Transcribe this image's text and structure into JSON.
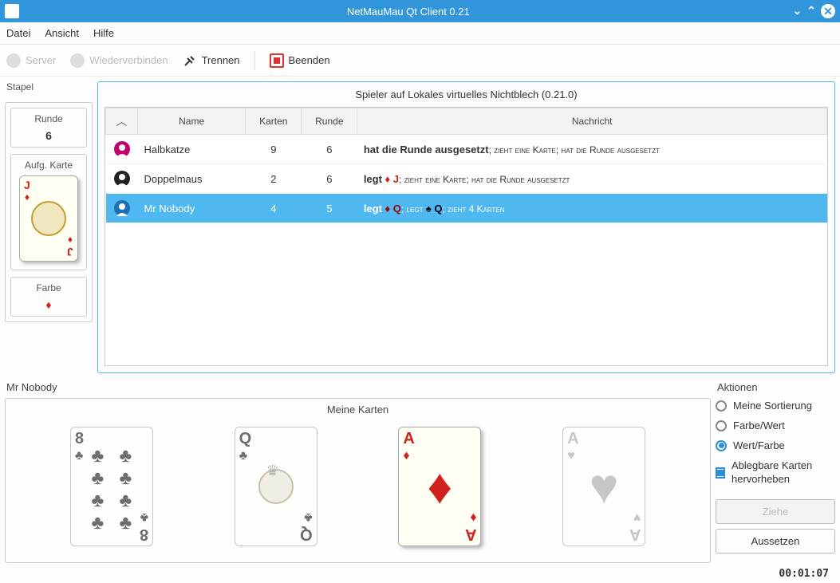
{
  "window": {
    "title": "NetMauMau Qt Client 0.21"
  },
  "menubar": {
    "file": "Datei",
    "view": "Ansicht",
    "help": "Hilfe"
  },
  "toolbar": {
    "server": "Server",
    "reconnect": "Wiederverbinden",
    "disconnect": "Trennen",
    "quit": "Beenden"
  },
  "stapel": {
    "title": "Stapel",
    "round_label": "Runde",
    "round_value": "6",
    "topcard_label": "Aufg. Karte",
    "topcard_rank": "J",
    "topcard_suit": "♦",
    "color_label": "Farbe",
    "color_value": "♦"
  },
  "server_panel": {
    "title": "Spieler auf Lokales virtuelles Nichtblech (0.21.0)",
    "columns": {
      "name": "Name",
      "cards": "Karten",
      "round": "Runde",
      "message": "Nachricht"
    },
    "rows": [
      {
        "name": "Halbkatze",
        "cards": "9",
        "round": "6",
        "msg_main": "hat die Runde ausgesetzt",
        "msg_rest": "; zieht eine Karte; hat die Runde ausgesetzt",
        "avatar_color": "#c1006b",
        "selected": false
      },
      {
        "name": "Doppelmaus",
        "cards": "2",
        "round": "6",
        "msg_main": "legt ",
        "msg_pip1_suit": "♦",
        "msg_pip1_rank": "J",
        "msg_pip1_color": "red",
        "msg_rest": "; zieht eine Karte; hat die Runde ausgesetzt",
        "avatar_color": "#222",
        "selected": false
      },
      {
        "name": "Mr Nobody",
        "cards": "4",
        "round": "5",
        "msg_main": "legt ",
        "msg_pip1_suit": "♦",
        "msg_pip1_rank": "Q",
        "msg_pip1_color": "red",
        "msg_mid": "; legt ",
        "msg_pip2_suit": "♠",
        "msg_pip2_rank": "Q",
        "msg_pip2_color": "black",
        "msg_rest": "; zieht 4 Karten",
        "avatar_color": "#1e6fb8",
        "selected": true
      }
    ]
  },
  "player": {
    "name": "Mr Nobody",
    "cards_title": "Meine Karten",
    "hand": [
      {
        "rank": "8",
        "suit": "♣",
        "color": "black",
        "layout": "pips8",
        "playable": false
      },
      {
        "rank": "Q",
        "suit": "♣",
        "color": "black",
        "layout": "face",
        "playable": false
      },
      {
        "rank": "A",
        "suit": "♦",
        "color": "red",
        "layout": "single",
        "playable": true
      },
      {
        "rank": "A",
        "suit": "♥",
        "color": "grey",
        "layout": "single",
        "playable": false
      }
    ]
  },
  "actions": {
    "title": "Aktionen",
    "sort_mine": "Meine Sortierung",
    "sort_suit_rank": "Farbe/Wert",
    "sort_rank_suit": "Wert/Farbe",
    "highlight": "Ablegbare Karten hervorheben",
    "draw": "Ziehe",
    "skip": "Aussetzen",
    "selected_sort": "sort_rank_suit",
    "highlight_on": true
  },
  "status": {
    "timer": "00:01:07"
  }
}
